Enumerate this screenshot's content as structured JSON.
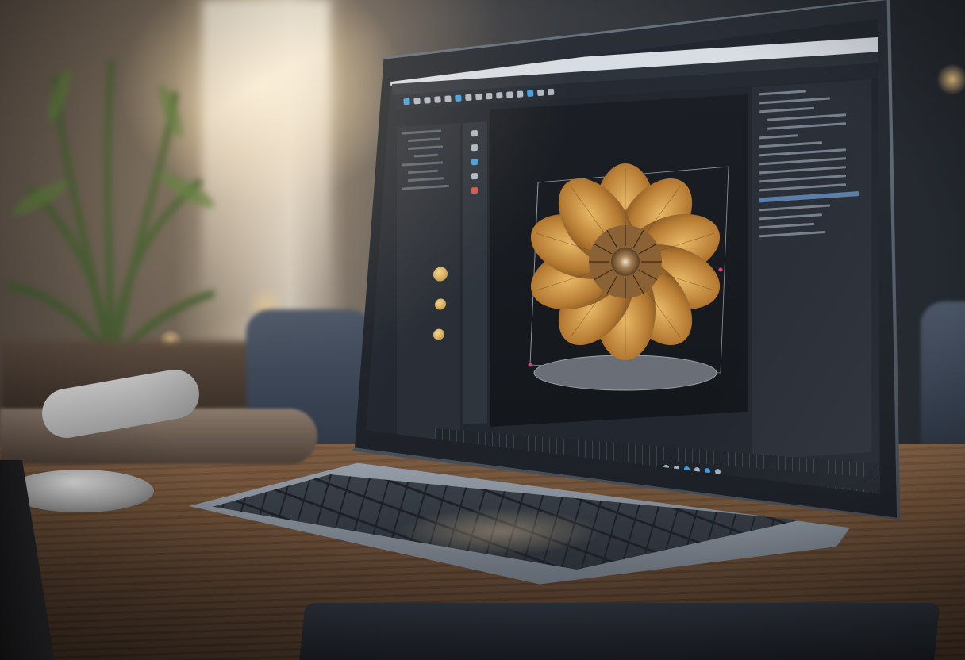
{
  "scene": {
    "description_icons": [
      "plant-icon",
      "laptop-icon",
      "mouse-icon",
      "remote-icon"
    ]
  },
  "app": {
    "title": "",
    "menu_items": [],
    "colors": {
      "accent": "#3fa0e0",
      "panel": "#2b3038",
      "viewport": "#1b1f25",
      "model_gold": "#c8913f"
    }
  }
}
